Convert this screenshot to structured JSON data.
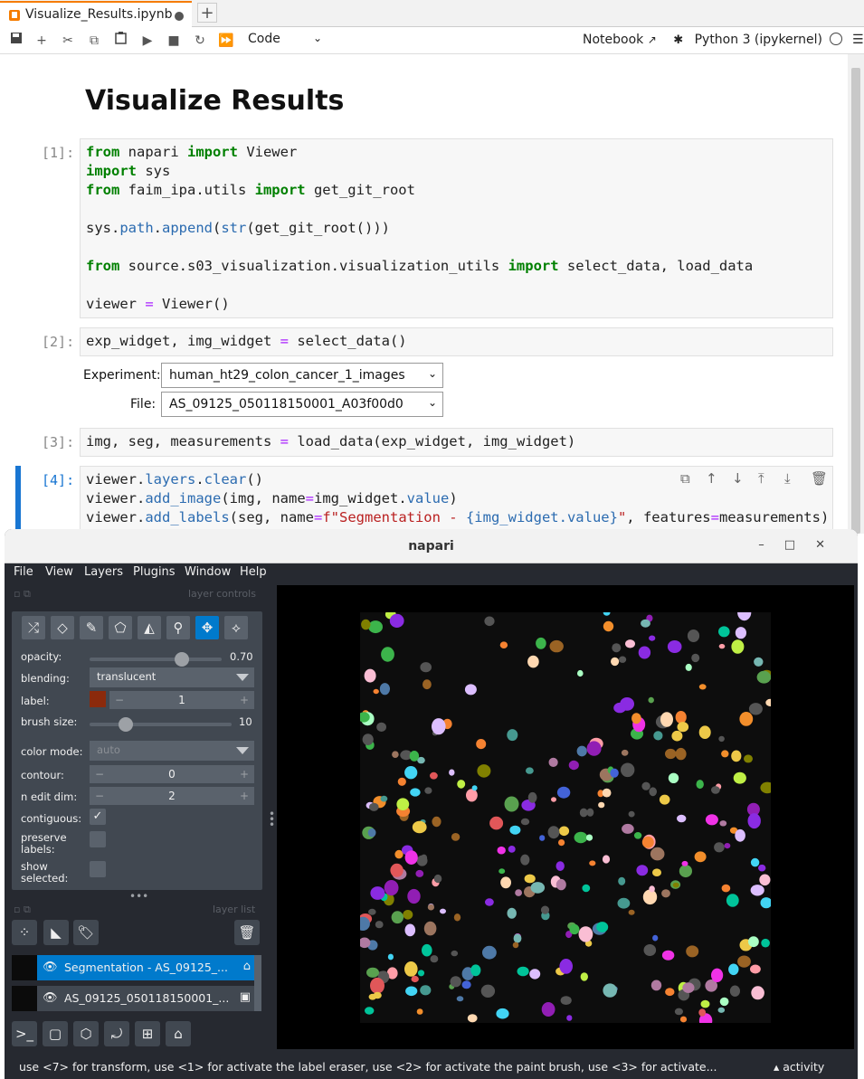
{
  "jupyter": {
    "tab_title": "Visualize_Results.ipynb",
    "new_tab": "+",
    "cell_type": "Code",
    "notebook_label": "Notebook",
    "kernel": "Python 3 (ipykernel)",
    "heading": "Visualize Results",
    "prompts": [
      "[1]:",
      "[2]:",
      "[3]:",
      "[4]:"
    ],
    "widgets": {
      "experiment_label": "Experiment:",
      "experiment_value": "human_ht29_colon_cancer_1_images",
      "file_label": "File:",
      "file_value": "AS_09125_050118150001_A03f00d0"
    }
  },
  "napari": {
    "title": "napari",
    "menu": [
      "File",
      "View",
      "Layers",
      "Plugins",
      "Window",
      "Help"
    ],
    "layer_controls_title": "layer controls",
    "layer_list_title": "layer list",
    "controls": {
      "opacity_label": "opacity:",
      "opacity_value": "0.70",
      "opacity_fraction": 0.7,
      "blending_label": "blending:",
      "blending_value": "translucent",
      "label_label": "label:",
      "label_value": "1",
      "label_color": "#8b2a0c",
      "brush_label": "brush size:",
      "brush_value": "10",
      "color_mode_label": "color mode:",
      "color_mode_value": "auto",
      "contour_label": "contour:",
      "contour_value": "0",
      "n_edit_label": "n edit dim:",
      "n_edit_value": "2",
      "contiguous_label": "contiguous:",
      "preserve_label": "preserve labels:",
      "show_selected_label": "show selected:"
    },
    "layers": [
      {
        "name": "Segmentation - AS_09125_...",
        "type": "labels-icon",
        "selected": true
      },
      {
        "name": "AS_09125_050118150001_...",
        "type": "image-icon",
        "selected": false
      }
    ],
    "status": "use <7> for transform, use <1> for activate the label eraser, use <2> for activate the paint brush, use <3> for activate...",
    "activity": "activity",
    "accent": "#007acc"
  }
}
